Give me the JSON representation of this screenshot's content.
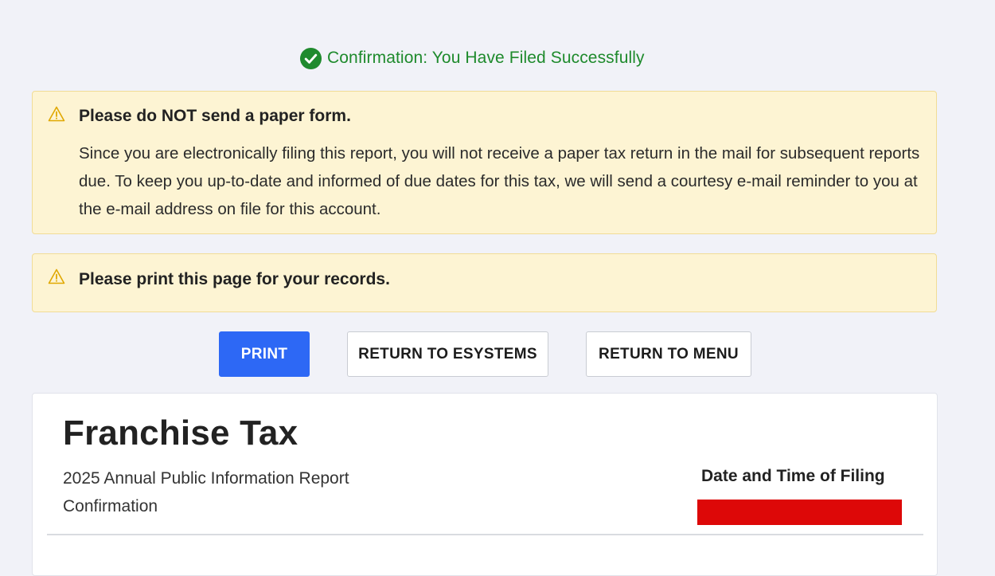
{
  "confirmation": {
    "icon": "check-circle-icon",
    "text": "Confirmation: You Have Filed Successfully",
    "color": "#1e8a2c"
  },
  "alerts": [
    {
      "icon": "warning-icon",
      "title": "Please do NOT send a paper form.",
      "body": "Since you are electronically filing this report, you will not receive a paper tax return in the mail for subsequent reports due. To keep you up-to-date and informed of due dates for this tax, we will send a courtesy e-mail reminder to you at the e-mail address on file for this account."
    },
    {
      "icon": "warning-icon",
      "title": "Please print this page for your records."
    }
  ],
  "buttons": {
    "print": "PRINT",
    "return_esystems": "RETURN TO ESYSTEMS",
    "return_menu": "RETURN TO MENU"
  },
  "card": {
    "title": "Franchise Tax",
    "subtitle_line1": "2025 Annual Public Information Report",
    "subtitle_line2": "Confirmation",
    "date_label": "Date and Time of Filing"
  },
  "colors": {
    "accent": "#2d68f5",
    "alert_bg": "#fdf4d3",
    "redaction": "#dd0808"
  }
}
